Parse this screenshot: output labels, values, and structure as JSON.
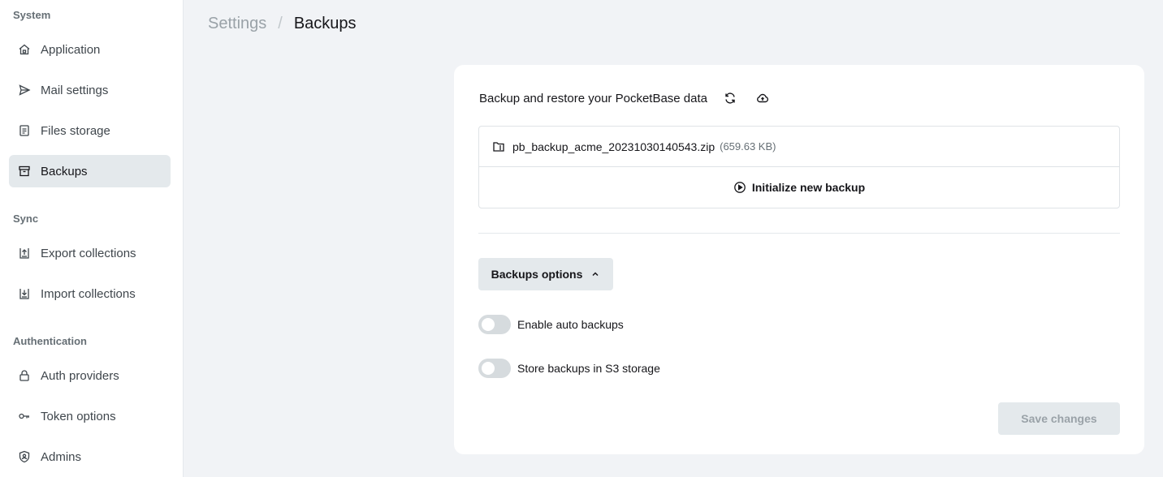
{
  "sidebar": {
    "groups": [
      {
        "title": "System"
      },
      {
        "title": "Sync"
      },
      {
        "title": "Authentication"
      }
    ],
    "items": [
      {
        "label": "Application",
        "icon": "home-icon"
      },
      {
        "label": "Mail settings",
        "icon": "send-icon"
      },
      {
        "label": "Files storage",
        "icon": "file-icon"
      },
      {
        "label": "Backups",
        "icon": "archive-icon",
        "active": true
      },
      {
        "label": "Export collections",
        "icon": "export-icon"
      },
      {
        "label": "Import collections",
        "icon": "import-icon"
      },
      {
        "label": "Auth providers",
        "icon": "lock-icon"
      },
      {
        "label": "Token options",
        "icon": "key-icon"
      },
      {
        "label": "Admins",
        "icon": "shield-user-icon"
      }
    ]
  },
  "breadcrumb": {
    "parent": "Settings",
    "separator": "/",
    "current": "Backups"
  },
  "panel": {
    "heading": "Backup and restore your PocketBase data",
    "refresh_icon": "refresh-icon",
    "upload_icon": "upload-cloud-icon",
    "backups": [
      {
        "name": "pb_backup_acme_20231030140543.zip",
        "size": "(659.63 KB)"
      }
    ],
    "init_label": "Initialize new backup",
    "options_label": "Backups options",
    "toggles": [
      {
        "label": "Enable auto backups",
        "enabled": false
      },
      {
        "label": "Store backups in S3 storage",
        "enabled": false
      }
    ],
    "save_label": "Save changes"
  },
  "colors": {
    "active_bg": "#e4e9ec",
    "muted_text": "#9aa2a8",
    "toggle_off": "#d6dbde"
  }
}
